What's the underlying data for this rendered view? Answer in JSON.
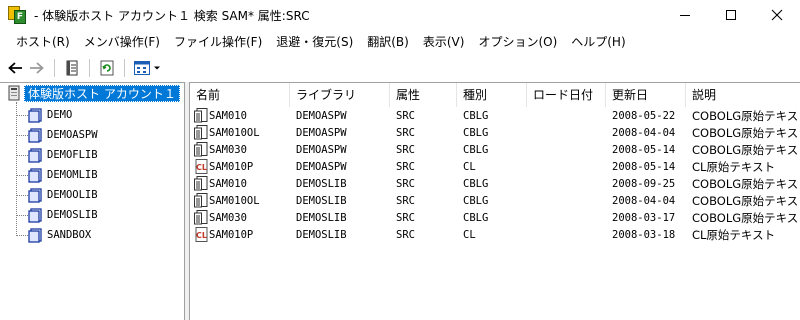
{
  "window": {
    "title": "- 体験版ホスト アカウント１ 検索 SAM* 属性:SRC",
    "app_icon_letter": "F"
  },
  "menu": [
    "ホスト(R)",
    "メンバ操作(F)",
    "ファイル操作(F)",
    "退避・復元(S)",
    "翻訳(B)",
    "表示(V)",
    "オプション(O)",
    "ヘルプ(H)"
  ],
  "tree": {
    "root": "体験版ホスト アカウント１",
    "children": [
      "DEMO",
      "DEMOASPW",
      "DEMOFLIB",
      "DEMOMLIB",
      "DEMOOLIB",
      "DEMOSLIB",
      "SANDBOX"
    ]
  },
  "list": {
    "columns": [
      "名前",
      "ライブラリ",
      "属性",
      "種別",
      "ロード日付",
      "更新日",
      "説明"
    ],
    "rows": [
      {
        "icon": "cobol-source-icon",
        "name": "SAM010",
        "library": "DEMOASPW",
        "attr": "SRC",
        "kind": "CBLG",
        "load_date": "",
        "updated": "2008-05-22",
        "desc": "COBOLG原始テキスト"
      },
      {
        "icon": "cobol-source-icon",
        "name": "SAM010OL",
        "library": "DEMOASPW",
        "attr": "SRC",
        "kind": "CBLG",
        "load_date": "",
        "updated": "2008-04-04",
        "desc": "COBOLG原始テキスト"
      },
      {
        "icon": "cobol-source-icon",
        "name": "SAM030",
        "library": "DEMOASPW",
        "attr": "SRC",
        "kind": "CBLG",
        "load_date": "",
        "updated": "2008-05-14",
        "desc": "COBOLG原始テキスト"
      },
      {
        "icon": "cl-source-icon",
        "name": "SAM010P",
        "library": "DEMOASPW",
        "attr": "SRC",
        "kind": "CL",
        "load_date": "",
        "updated": "2008-05-14",
        "desc": "CL原始テキスト"
      },
      {
        "icon": "cobol-source-icon",
        "name": "SAM010",
        "library": "DEMOSLIB",
        "attr": "SRC",
        "kind": "CBLG",
        "load_date": "",
        "updated": "2008-09-25",
        "desc": "COBOLG原始テキスト"
      },
      {
        "icon": "cobol-source-icon",
        "name": "SAM010OL",
        "library": "DEMOSLIB",
        "attr": "SRC",
        "kind": "CBLG",
        "load_date": "",
        "updated": "2008-04-04",
        "desc": "COBOLG原始テキスト"
      },
      {
        "icon": "cobol-source-icon",
        "name": "SAM030",
        "library": "DEMOSLIB",
        "attr": "SRC",
        "kind": "CBLG",
        "load_date": "",
        "updated": "2008-03-17",
        "desc": "COBOLG原始テキスト"
      },
      {
        "icon": "cl-source-icon",
        "name": "SAM010P",
        "library": "DEMOSLIB",
        "attr": "SRC",
        "kind": "CL",
        "load_date": "",
        "updated": "2008-03-18",
        "desc": "CL原始テキスト"
      }
    ]
  },
  "colors": {
    "selection": "#0078d7",
    "cl_icon": "#c0392b",
    "library_icon": "#1a3aa0"
  }
}
